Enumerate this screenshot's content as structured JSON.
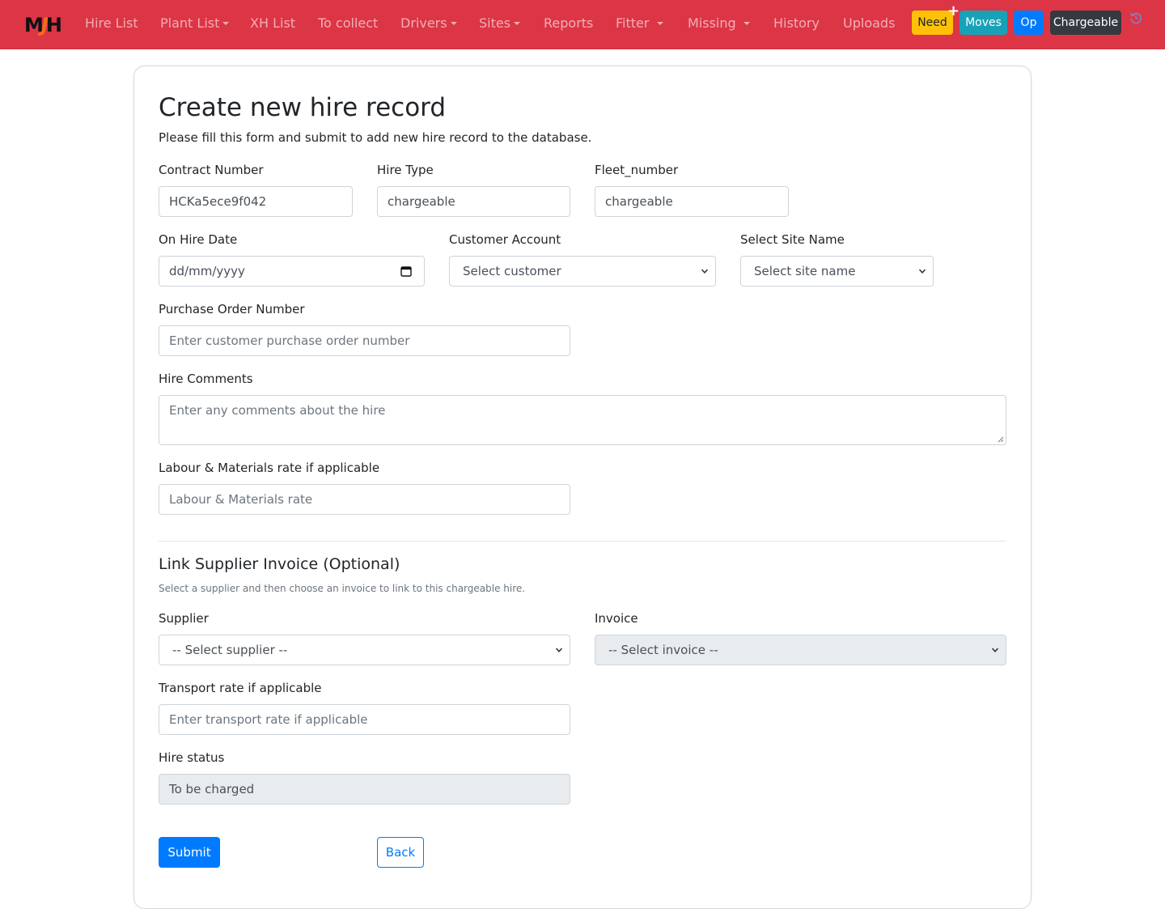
{
  "navbar": {
    "logo": {
      "left": "M",
      "middle": "J",
      "right": "H"
    },
    "items": [
      {
        "label": "Hire List",
        "dropdown": false
      },
      {
        "label": "Plant List",
        "dropdown": true
      },
      {
        "label": "XH List",
        "dropdown": false
      },
      {
        "label": "To collect",
        "dropdown": false
      },
      {
        "label": "Drivers",
        "dropdown": true
      },
      {
        "label": "Sites",
        "dropdown": true
      },
      {
        "label": "Reports",
        "dropdown": false
      },
      {
        "label": "Fitter",
        "dropdown": true
      },
      {
        "label": "Missing",
        "dropdown": true
      },
      {
        "label": "History",
        "dropdown": false
      },
      {
        "label": "Uploads",
        "dropdown": false
      }
    ],
    "buttons": {
      "need": "Need",
      "moves": "Moves",
      "op": "Op",
      "chargeable": "Chargeable"
    },
    "colors": {
      "bar": "#dc3545",
      "need": "#ffc107",
      "moves": "#17a2b8",
      "op": "#007bff",
      "chargeable": "#343a40"
    }
  },
  "form": {
    "title": "Create new hire record",
    "description": "Please fill this form and submit to add new hire record to the database.",
    "contract_number": {
      "label": "Contract Number",
      "value": "HCKa5ece9f042"
    },
    "hire_type": {
      "label": "Hire Type",
      "value": "chargeable"
    },
    "fleet_number": {
      "label": "Fleet_number",
      "value": "chargeable"
    },
    "on_hire_date": {
      "label": "On Hire Date",
      "placeholder": "dd/mm/yyyy"
    },
    "customer_account": {
      "label": "Customer Account",
      "selected": "Select customer"
    },
    "site_name": {
      "label": "Select Site Name",
      "selected": "Select site name"
    },
    "purchase_order": {
      "label": "Purchase Order Number",
      "placeholder": "Enter customer purchase order number"
    },
    "hire_comments": {
      "label": "Hire Comments",
      "placeholder": "Enter any comments about the hire"
    },
    "labour_rate": {
      "label": "Labour & Materials rate if applicable",
      "placeholder": "Labour & Materials rate"
    },
    "supplier_section": {
      "title": "Link Supplier Invoice (Optional)",
      "help": "Select a supplier and then choose an invoice to link to this chargeable hire."
    },
    "supplier": {
      "label": "Supplier",
      "selected": "-- Select supplier --"
    },
    "invoice": {
      "label": "Invoice",
      "selected": "-- Select invoice --"
    },
    "transport_rate": {
      "label": "Transport rate if applicable",
      "placeholder": "Enter transport rate if applicable"
    },
    "hire_status": {
      "label": "Hire status",
      "value": "To be charged"
    },
    "submit_label": "Submit",
    "back_label": "Back"
  }
}
